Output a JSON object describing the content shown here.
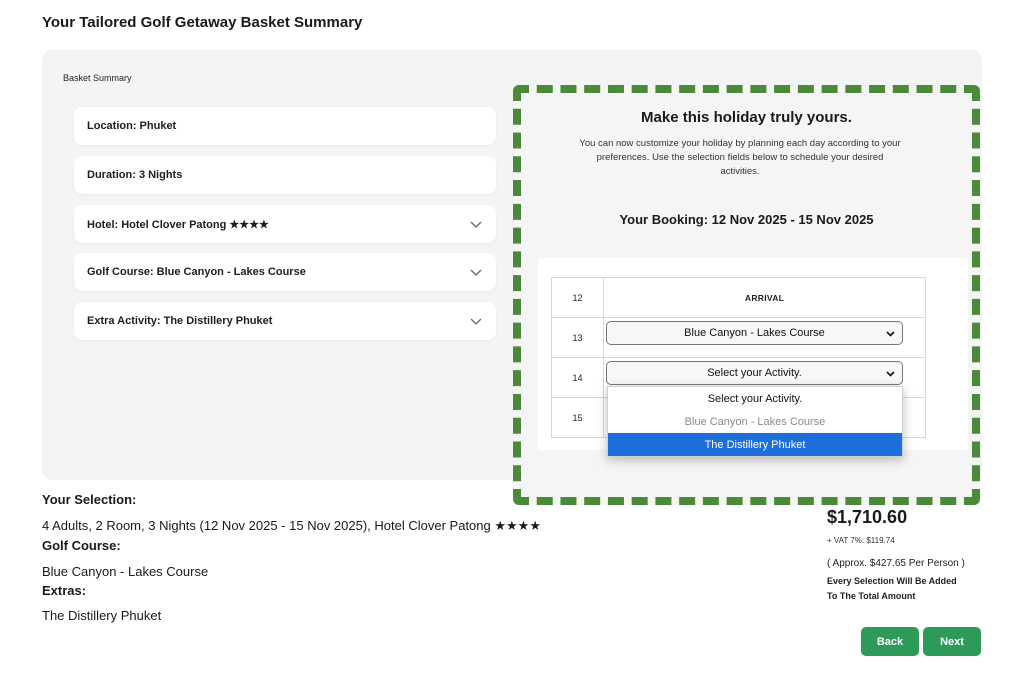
{
  "page": {
    "title": "Your Tailored Golf Getaway Basket Summary"
  },
  "basket": {
    "label": "Basket Summary",
    "rows": [
      {
        "text": "Location: Phuket",
        "expandable": false
      },
      {
        "text": "Duration: 3 Nights",
        "expandable": false
      },
      {
        "text": "Hotel: Hotel Clover Patong ★★★★",
        "expandable": true,
        "icon": "chevron-down-icon"
      },
      {
        "text": "Golf Course: Blue Canyon - Lakes Course",
        "expandable": true,
        "icon": "chevron-down-icon"
      },
      {
        "text": "Extra Activity: The Distillery Phuket",
        "expandable": true,
        "icon": "chevron-down-icon"
      }
    ]
  },
  "customize": {
    "title": "Make this holiday truly yours.",
    "description": "You can now customize your holiday by planning each day according to your preferences. Use the selection fields below to schedule your desired activities.",
    "booking": "Your Booking: 12 Nov 2025 - 15 Nov 2025",
    "schedule": [
      {
        "day": "12",
        "content": "ARRIVAL"
      },
      {
        "day": "13",
        "select": "Blue Canyon - Lakes Course"
      },
      {
        "day": "14",
        "select": "Select your Activity."
      },
      {
        "day": "15",
        "select": ""
      }
    ],
    "dropdown": {
      "options": [
        {
          "label": "Select your Activity.",
          "state": "normal"
        },
        {
          "label": "Blue Canyon - Lakes Course",
          "state": "disabled"
        },
        {
          "label": "The Distillery Phuket",
          "state": "highlighted"
        }
      ]
    },
    "highlight_color": "#1e6fd9",
    "border_color": "#4a8a3a"
  },
  "selection": {
    "heading": "Your Selection:",
    "summary": "4 Adults, 2 Room, 3 Nights (12 Nov 2025 - 15 Nov 2025), Hotel Clover Patong ★★★★",
    "golf_heading": "Golf Course:",
    "golf_value": "Blue Canyon - Lakes Course",
    "extras_heading": "Extras:",
    "extras_value": "The Distillery Phuket"
  },
  "pricing": {
    "total": "$1,710.60",
    "vat": "+ VAT 7%: $119.74",
    "approx": "( Approx. $427.65 Per Person )",
    "note_line1": "Every Selection Will Be Added",
    "note_line2": "To The Total Amount"
  },
  "actions": {
    "back": "Back",
    "next": "Next",
    "button_color": "#2d9a5a"
  }
}
